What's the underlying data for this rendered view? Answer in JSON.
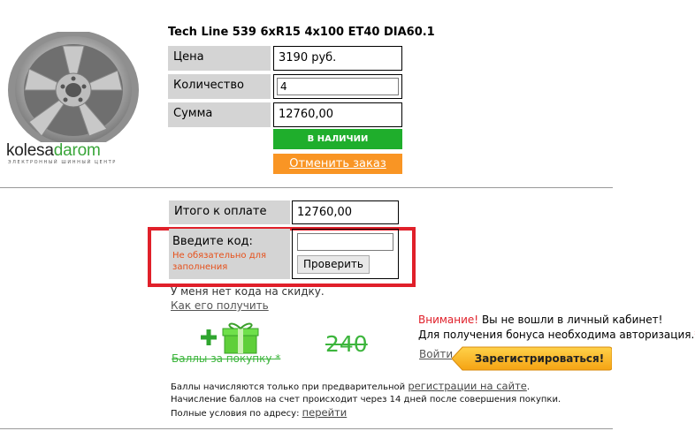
{
  "product": {
    "title": "Tech Line 539 6xR15 4x100 ET40 DIA60.1",
    "logo_main": "kolesa",
    "logo_accent": "darom",
    "logo_sub": "ЭЛЕКТРОННЫЙ ШИННЫЙ ЦЕНТР"
  },
  "order": {
    "price_label": "Цена",
    "price_value": "3190 руб.",
    "qty_label": "Количество",
    "qty_value": "4",
    "sum_label": "Сумма",
    "sum_value": "12760,00",
    "in_stock_label": "В НАЛИЧИИ",
    "cancel_label": "Отменить заказ"
  },
  "payment": {
    "total_label": "Итого к оплате",
    "total_value": "12760,00",
    "code_label": "Введите код:",
    "code_hint_line1": "Не обязательно для",
    "code_hint_line2": "заполнения",
    "code_value": "",
    "check_label": "Проверить",
    "no_code_text": "У меня нет кода на скидку.",
    "how_link": "Как его получить"
  },
  "bonus": {
    "points_label": "Баллы за покупку *",
    "points_value": "240",
    "warning_word": "Внимание!",
    "warning_rest": " Вы не вошли в личный кабинет!",
    "auth_text": "Для получения бонуса необходима авторизация.",
    "auth_star": "*",
    "login_link": "Войти",
    "register_label": "Зарегистрироваться!"
  },
  "info": {
    "part1": "Баллы начисляются только при предварительной ",
    "link1": "регистрации на сайте",
    "part2": ". Начисление баллов на счет происходит через 14 дней после совершения покупки. Полные условия по адресу: ",
    "link2": "перейти"
  },
  "colors": {
    "green": "#1fae2c",
    "orange": "#f99524",
    "red": "#e0202a",
    "label_gray": "#d4d4d4"
  }
}
